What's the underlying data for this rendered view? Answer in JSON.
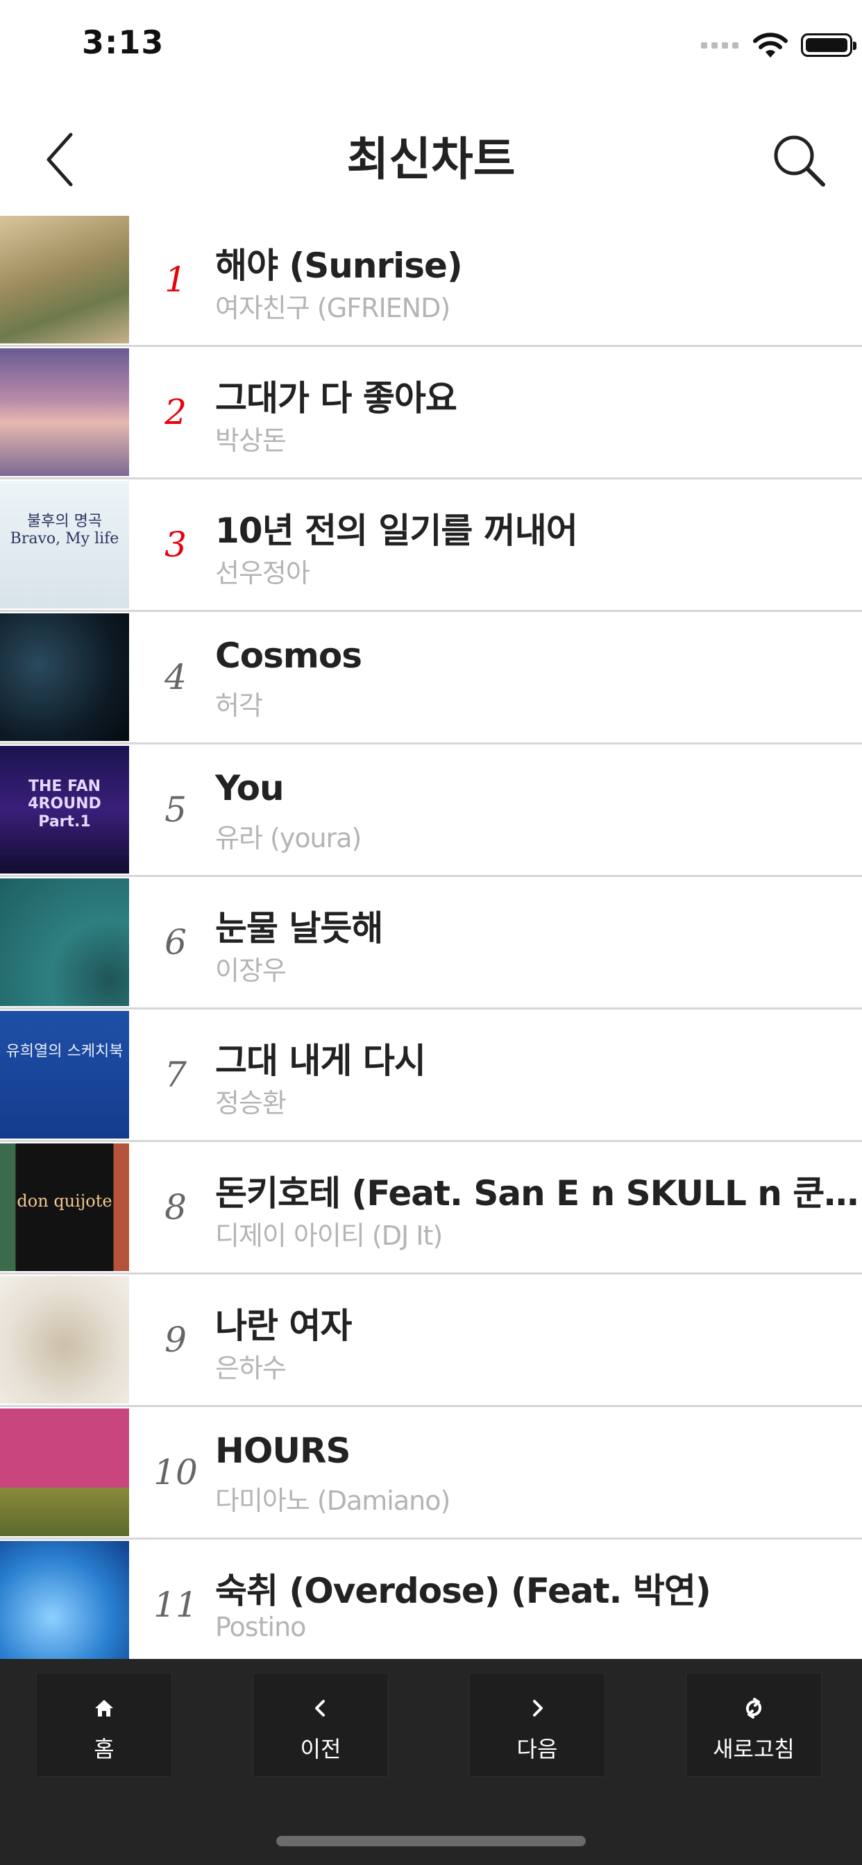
{
  "status_bar": {
    "time": "3:13"
  },
  "nav": {
    "title": "최신차트"
  },
  "chart": [
    {
      "rank": "1",
      "title": "해야 (Sunrise)",
      "artist": "여자친구 (GFRIEND)",
      "highlight": true,
      "cover_text": ""
    },
    {
      "rank": "2",
      "title": "그대가 다 좋아요",
      "artist": "박상돈",
      "highlight": true,
      "cover_text": ""
    },
    {
      "rank": "3",
      "title": "10년 전의 일기를 꺼내어",
      "artist": "선우정아",
      "highlight": true,
      "cover_text": "불후의 명곡 Bravo, My life"
    },
    {
      "rank": "4",
      "title": "Cosmos",
      "artist": "허각",
      "highlight": false,
      "cover_text": ""
    },
    {
      "rank": "5",
      "title": "You",
      "artist": "유라 (youra)",
      "highlight": false,
      "cover_text": "THE FAN 4ROUND Part.1"
    },
    {
      "rank": "6",
      "title": "눈물 날듯해",
      "artist": "이장우",
      "highlight": false,
      "cover_text": ""
    },
    {
      "rank": "7",
      "title": "그대 내게 다시",
      "artist": "정승환",
      "highlight": false,
      "cover_text": "유희열의 스케치북"
    },
    {
      "rank": "8",
      "title": "돈키호테 (Feat. San E n SKULL n 쿤타 (Koonta))",
      "artist": "디제이 아이티 (DJ It)",
      "highlight": false,
      "cover_text": "don quijote"
    },
    {
      "rank": "9",
      "title": "나란 여자",
      "artist": "은하수",
      "highlight": false,
      "cover_text": ""
    },
    {
      "rank": "10",
      "title": "HOURS",
      "artist": "다미아노 (Damiano)",
      "highlight": false,
      "cover_text": ""
    },
    {
      "rank": "11",
      "title": "숙취 (Overdose) (Feat. 박연)",
      "artist": "Postino",
      "highlight": false,
      "cover_text": ""
    }
  ],
  "bottom_tabs": [
    {
      "label": "홈",
      "icon": "home-icon"
    },
    {
      "label": "이전",
      "icon": "chevron-left-icon"
    },
    {
      "label": "다음",
      "icon": "chevron-right-icon"
    },
    {
      "label": "새로고침",
      "icon": "refresh-icon"
    }
  ],
  "colors": {
    "rank_highlight": "#e8000b",
    "artist_gray": "#b4b4b4",
    "bottom_bar": "#252525"
  }
}
